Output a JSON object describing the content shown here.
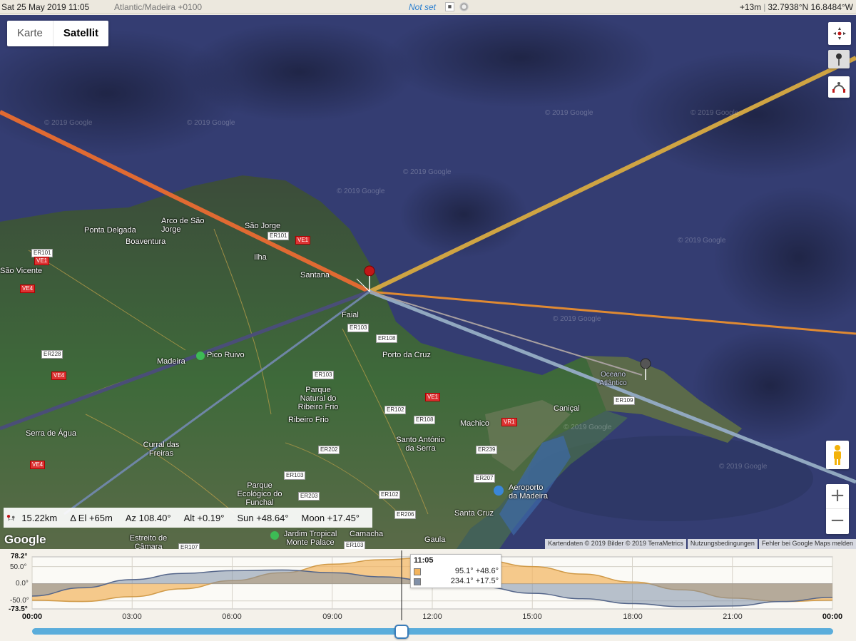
{
  "topbar": {
    "datetime": "Sat 25 May 2019 11:05",
    "timezone": "Atlantic/Madeira +0100",
    "not_set": "Not set",
    "elevation": "+13m",
    "coordinates": "32.7938°N 16.8484°W"
  },
  "map": {
    "type_buttons": [
      "Karte",
      "Satellit"
    ],
    "active_type": "Satellit",
    "google_logo": "Google",
    "footer": [
      "Kartendaten © 2019 Bilder © 2019 TerraMetrics",
      "Nutzungsbedingungen",
      "Fehler bei Google Maps melden"
    ],
    "watermark": "© 2019 Google",
    "places": [
      "Ponta Delgada",
      "Arco de São Jorge",
      "Boaventura",
      "São Jorge",
      "Ilha",
      "Santana",
      "São Vicente",
      "Faial",
      "Porto da Cruz",
      "Madeira",
      "Pico Ruivo",
      "Parque Natural do Ribeiro Frio",
      "Ribeiro Frio",
      "Serra de Água",
      "Curral das Freiras",
      "Machico",
      "Caniçal",
      "Oceano Atlântico",
      "Santo António da Serra",
      "Aeroporto da Madeira",
      "Parque Ecológico do Funchal",
      "Santa Cruz",
      "Estreito de Câmara",
      "Jardim Tropical Monte Palace",
      "Camacha",
      "Gaula"
    ],
    "roads": [
      "ER101",
      "VE1",
      "ER101",
      "VE1",
      "VE4",
      "ER228",
      "VE4",
      "ER103",
      "ER108",
      "ER103",
      "VE1",
      "ER102",
      "ER108",
      "VR1",
      "ER109",
      "ER202",
      "ER239",
      "ER103",
      "ER207",
      "ER203",
      "ER102",
      "ER206",
      "ER107",
      "ER103",
      "VE4"
    ],
    "zoom_in": "+",
    "zoom_out": "−"
  },
  "infobar": {
    "distance": "15.22km",
    "delta_el": "Δ El  +65m",
    "azimuth": "Az 108.40°",
    "altitude": "Alt +0.19°",
    "sun": "Sun +48.64°",
    "moon": "Moon +17.45°"
  },
  "colors": {
    "sun": "#f2b45e",
    "moon": "#8090a8",
    "slider": "#5aaddb"
  },
  "chart_data": {
    "type": "area",
    "x_labels": [
      "00:00",
      "03:00",
      "06:00",
      "09:00",
      "12:00",
      "15:00",
      "18:00",
      "21:00",
      "00:00"
    ],
    "y_labels": [
      "78.2°",
      "50.0°",
      "0.0°",
      "-50.0°",
      "-73.5°"
    ],
    "ylim": [
      -73.5,
      78.2
    ],
    "x_hours": [
      0,
      1.5,
      3,
      4.5,
      6,
      7.5,
      9,
      10.5,
      12,
      13.5,
      15,
      16.5,
      18,
      19.5,
      21,
      22.5,
      24
    ],
    "series": [
      {
        "name": "Sun",
        "values": [
          -48,
          -52,
          -38,
          -15,
          9,
          32,
          57,
          70,
          77,
          68,
          50,
          28,
          5,
          -18,
          -42,
          -52,
          -48
        ]
      },
      {
        "name": "Moon",
        "values": [
          -36,
          -12,
          12,
          30,
          38,
          40,
          32,
          20,
          8,
          -10,
          -28,
          -44,
          -58,
          -67,
          -65,
          -52,
          -40
        ]
      }
    ],
    "current_time": "11:05",
    "current_hour": 11.08,
    "tooltip": {
      "time": "11:05",
      "sun": "95.1°  +48.6°",
      "moon": "234.1°  +17.5°"
    }
  }
}
